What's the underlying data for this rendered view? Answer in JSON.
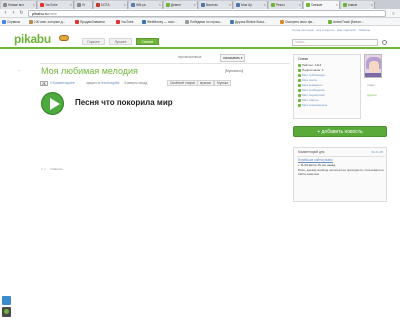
{
  "browser": {
    "tabs": [
      {
        "label": "Новые вкл"
      },
      {
        "label": "YouTube"
      },
      {
        "label": "Ут"
      },
      {
        "label": "DOTA"
      },
      {
        "label": "WB:ра"
      },
      {
        "label": "Демен"
      },
      {
        "label": "Вконтак"
      },
      {
        "label": "Мои Ау"
      },
      {
        "label": "Рекло"
      },
      {
        "label": "Свежие"
      },
      {
        "label": "новые"
      }
    ],
    "url_host": "pikabu.ru",
    "url_path": "/new",
    "bookmarks": [
      {
        "label": "Сервисы",
        "color": "#4285f4"
      },
      {
        "label": "100 книг, которые д...",
        "color": "#b58b4b"
      },
      {
        "label": "ПродаюЗнамели",
        "color": "#e0332d"
      },
      {
        "label": "YouTube",
        "color": "#e0332d"
      },
      {
        "label": "WebMoney — сист...",
        "color": "#3b6fb6"
      },
      {
        "label": "Победимо по страш...",
        "color": "#9a9a9a"
      },
      {
        "label": "Друзья Blinkie Buna...",
        "color": "#4a76a8"
      },
      {
        "label": "Смотреть кино фи...",
        "color": "#d68b2a"
      },
      {
        "label": "AnimeTrack [Белоп...",
        "color": "#6fb53a"
      }
    ]
  },
  "site": {
    "logo": "pikabu",
    "nav": [
      "Горячее",
      "Лучшее",
      "Свежее"
    ],
    "user_links": [
      "Сетка пестеров",
      "ник и пароль",
      "мои подписки",
      "Помощь"
    ],
    "search_placeholder": "поиск..."
  },
  "filters": {
    "items": [
      "просмотренные",
      "показывать"
    ],
    "selected": "показывать ▾"
  },
  "post": {
    "title": "Моя любимая мелодия",
    "author_link": "[Мультик.ru]",
    "rating": "+",
    "meta_count": "28",
    "comments_text": "0 Комментариев",
    "posted_text": "прицел от",
    "author": "Hardmegaffa",
    "time": "3 минуты назад",
    "tags": [
      "Своё/моё старое",
      "музыка",
      "Мульки"
    ],
    "song": "Песня что покорила мир",
    "actions": "Ответить"
  },
  "sidebar": {
    "username": "Олеян",
    "rows": [
      {
        "label": "Рейтинг: 1414",
        "plain": true
      },
      {
        "label": "Подписчиков: 3",
        "plain": true
      },
      {
        "label": "Мои публикации",
        "plain": false
      },
      {
        "label": "Моя лента",
        "plain": false
      },
      {
        "label": "Мои комменты",
        "plain": false
      },
      {
        "label": "Мои сообщения",
        "plain": false
      },
      {
        "label": "Мои подписчики",
        "plain": false
      },
      {
        "label": "Мои ответы",
        "plain": false
      },
      {
        "label": "Мои сохранённые",
        "plain": false
      }
    ],
    "side_icons": [
      "отмет",
      "друзья"
    ],
    "add_news": "+ добавить новость",
    "comments_box": {
      "title": "Комментарий дня",
      "date": "31.01.05",
      "post_link": "Новейшие сайта pikabu",
      "author": "+ 11:29  автор 15 лет назад",
      "text": "Блин, адемку вообще пытаться не приходится, пользователи сайта сами все"
    }
  },
  "colors": {
    "accent": "#6fb53a",
    "link": "#6a8ec7",
    "play_button": "#4caa3c"
  }
}
